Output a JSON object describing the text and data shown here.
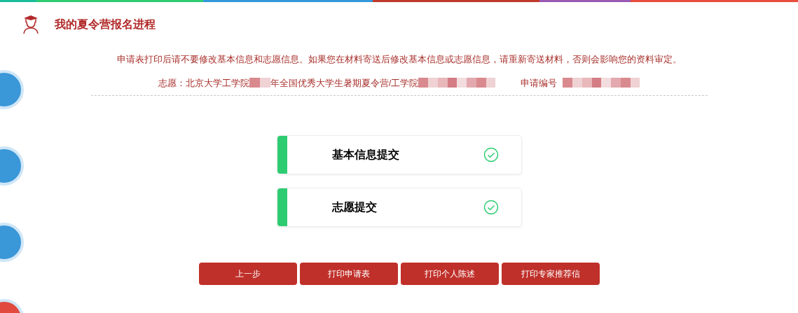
{
  "header": {
    "title": "我的夏令营报名进程"
  },
  "notice": "申请表打印后请不要修改基本信息和志愿信息。如果您在材料寄送后修改基本信息或志愿信息，请重新寄送材料，否则会影响您的资料审定。",
  "choice": {
    "label": "志愿：北京大学工学院",
    "middle": "年全国优秀大学生暑期夏令营/工学院",
    "number_label": "申请编号"
  },
  "side_steps": [
    {
      "color": "#3a97d8"
    },
    {
      "color": "#3a97d8"
    },
    {
      "color": "#3a97d8"
    },
    {
      "color": "#e04a3f"
    }
  ],
  "steps": [
    {
      "label": "基本信息提交",
      "done": true
    },
    {
      "label": "志愿提交",
      "done": true
    }
  ],
  "buttons": [
    "上一步",
    "打印申请表",
    "打印个人陈述",
    "打印专家推荐信"
  ]
}
